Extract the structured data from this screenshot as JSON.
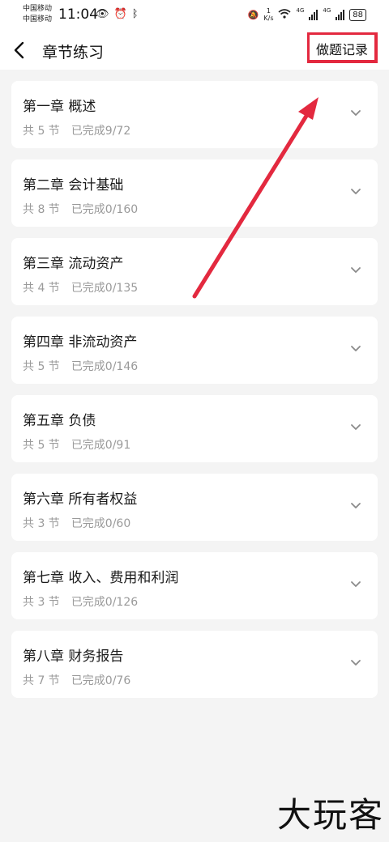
{
  "status_bar": {
    "carrier_1": "中国移动",
    "carrier_2": "中国移动",
    "time": "11:04",
    "net_speed_value": "1",
    "net_speed_unit": "K/s",
    "network_1": "4G",
    "network_2": "4G",
    "battery": "88"
  },
  "header": {
    "title": "章节练习",
    "record_label": "做题记录"
  },
  "chapters": [
    {
      "title": "第一章 概述",
      "sections": "共 5 节",
      "progress": "已完成9/72"
    },
    {
      "title": "第二章 会计基础",
      "sections": "共 8 节",
      "progress": "已完成0/160"
    },
    {
      "title": "第三章 流动资产",
      "sections": "共 4 节",
      "progress": "已完成0/135"
    },
    {
      "title": "第四章 非流动资产",
      "sections": "共 5 节",
      "progress": "已完成0/146"
    },
    {
      "title": "第五章 负债",
      "sections": "共 5 节",
      "progress": "已完成0/91"
    },
    {
      "title": "第六章 所有者权益",
      "sections": "共 3 节",
      "progress": "已完成0/60"
    },
    {
      "title": "第七章 收入、费用和利润",
      "sections": "共 3 节",
      "progress": "已完成0/126"
    },
    {
      "title": "第八章 财务报告",
      "sections": "共 7 节",
      "progress": "已完成0/76"
    }
  ],
  "watermark": "大玩客",
  "colors": {
    "highlight": "#e3293f",
    "background": "#f4f4f4",
    "card": "#ffffff",
    "meta_text": "#9a9a9a"
  },
  "icons": {
    "back": "chevron-left-icon",
    "expand": "chevron-down-icon"
  }
}
